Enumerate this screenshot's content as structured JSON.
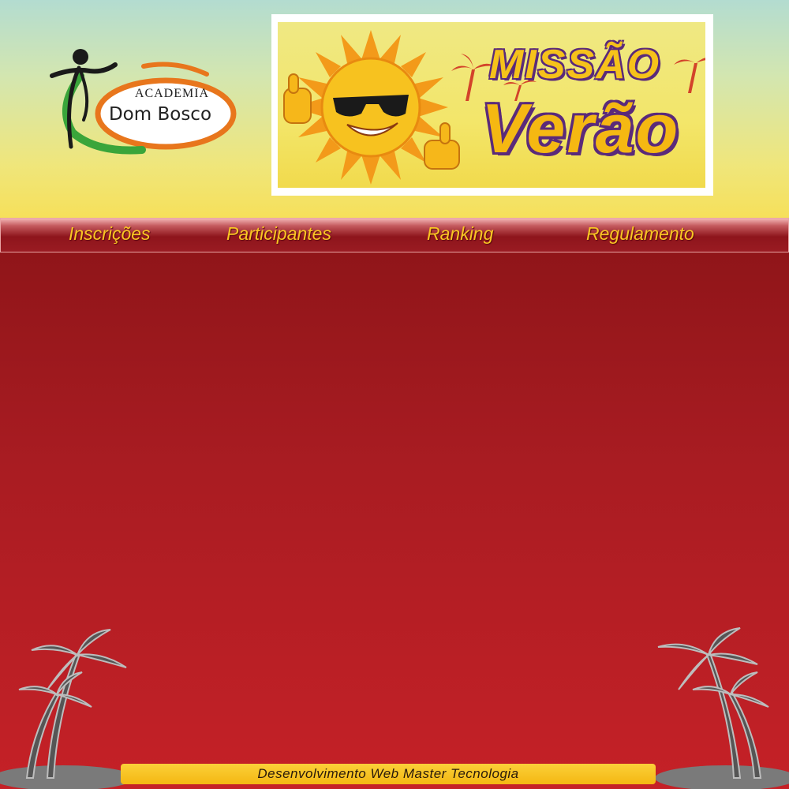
{
  "header": {
    "logo": {
      "line1": "ACADEMIA",
      "line2": "Dom Bosco"
    },
    "banner": {
      "word1": "MISSÃO",
      "word2": "Verão",
      "icons": [
        "sun-mascot-icon",
        "palm-tree-icon"
      ]
    }
  },
  "nav": {
    "items": [
      {
        "label": "Inscrições"
      },
      {
        "label": "Participantes"
      },
      {
        "label": "Ranking"
      },
      {
        "label": "Regulamento"
      }
    ]
  },
  "footer": {
    "credit": "Desenvolvimento Web Master Tecnologia"
  },
  "colors": {
    "nav_text": "#f9c623",
    "content_red": "#a91c22",
    "footer_yellow": "#f4b712",
    "logo_green": "#3aa53a",
    "logo_orange": "#e8761c"
  }
}
